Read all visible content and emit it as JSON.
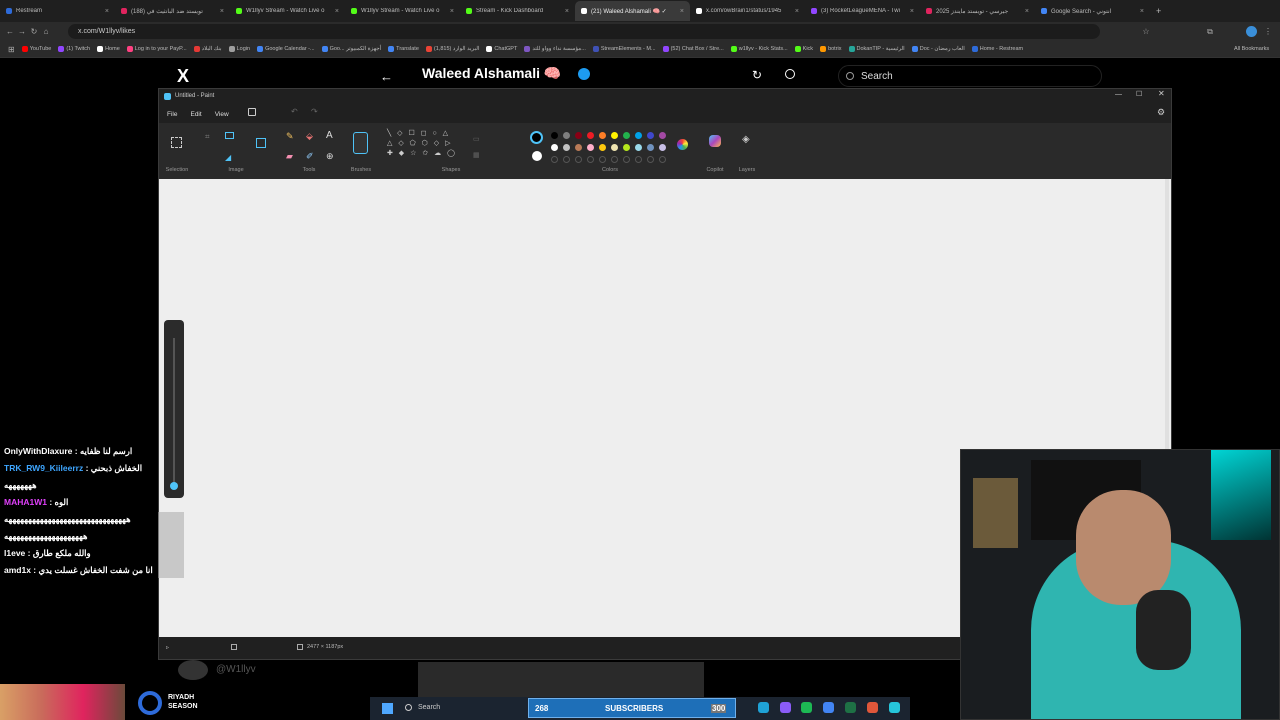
{
  "browser": {
    "tabs": [
      {
        "label": "Restream",
        "color": "#2e6bd9"
      },
      {
        "label": "تويستد ضد البانثيث في (188)",
        "color": "#e0245e"
      },
      {
        "label": "W1llyv Stream - Watch Live o",
        "color": "#53fc18"
      },
      {
        "label": "W1llyv Stream - Watch Live o",
        "color": "#53fc18"
      },
      {
        "label": "Stream - Kick Dashboard",
        "color": "#53fc18"
      },
      {
        "label": "(21) Waleed Alshamali 🧠 ✓",
        "color": "#ffffff"
      },
      {
        "label": "x.com/owBrain1/status/1945",
        "color": "#ffffff"
      },
      {
        "label": "(3) RocketLeagueMENA - Twi",
        "color": "#9146ff"
      },
      {
        "label": "جيرسي - تويستد مايندز 2025",
        "color": "#e0245e"
      },
      {
        "label": "Google Search - انتوني",
        "color": "#4285f4"
      }
    ],
    "url": "x.com/W1llyv/likes",
    "bookmarks": [
      {
        "label": "YouTube",
        "color": "#ff0000"
      },
      {
        "label": "(1) Twitch",
        "color": "#9146ff"
      },
      {
        "label": "Home",
        "color": "#ffffff"
      },
      {
        "label": "Log in to your PayP...",
        "color": "#ff4081"
      },
      {
        "label": "بنك البلاد",
        "color": "#e53935"
      },
      {
        "label": "Login",
        "color": "#9e9e9e"
      },
      {
        "label": "Google Calendar -...",
        "color": "#4285f4"
      },
      {
        "label": "Goo... أجهزة الكمبيوتر",
        "color": "#4285f4"
      },
      {
        "label": "Translate",
        "color": "#4285f4"
      },
      {
        "label": "(1,815) البريد الوارد",
        "color": "#ea4335"
      },
      {
        "label": "ChatGPT",
        "color": "#ffffff"
      },
      {
        "label": "مؤسسة نداء وواو للتد...",
        "color": "#7e57c2"
      },
      {
        "label": "StreamElements - M...",
        "color": "#3f51b5"
      },
      {
        "label": "(52) Chat Box / Stre...",
        "color": "#9146ff"
      },
      {
        "label": "w1llyv - Kick Stats...",
        "color": "#53fc18"
      },
      {
        "label": "Kick",
        "color": "#53fc18"
      },
      {
        "label": "botrix",
        "color": "#ff9800"
      },
      {
        "label": "DokanTIP - الرئيسية",
        "color": "#26a69a"
      },
      {
        "label": "Doc - العاب رمضان",
        "color": "#4285f4"
      },
      {
        "label": "Home - Restream",
        "color": "#2e6bd9"
      }
    ],
    "all_bookmarks": "All Bookmarks"
  },
  "x_page": {
    "logo": "X",
    "profile_name": "Waleed Alshamali 🧠",
    "search_placeholder": "Search",
    "footer_handle": "@W1llyv"
  },
  "paint": {
    "title": "Untitled - Paint",
    "menu": [
      "File",
      "Edit",
      "View"
    ],
    "groups": {
      "selection": "Selection",
      "image": "Image",
      "tools": "Tools",
      "brushes": "Brushes",
      "shapes": "Shapes",
      "colors": "Colors",
      "copilot": "Copilot",
      "layers": "Layers"
    },
    "palette_row1": [
      "#000000",
      "#7f7f7f",
      "#880015",
      "#ed1c24",
      "#ff7f27",
      "#fff200",
      "#22b14c",
      "#00a2e8",
      "#3f48cc",
      "#a349a4"
    ],
    "palette_row2": [
      "#ffffff",
      "#c3c3c3",
      "#b97a57",
      "#ffaec9",
      "#ffc90e",
      "#efe4b0",
      "#b5e61d",
      "#99d9ea",
      "#7092be",
      "#c8bfe7"
    ],
    "canvas_size": "2477 × 1187px"
  },
  "chat": [
    {
      "user": "OnlyWithDlaxure",
      "text": "ارسم لنا ظفايه",
      "user_color": "#ffffff"
    },
    {
      "user": "TRK_RW9_Kiileerrz",
      "text": "الخفاش ذبحني",
      "user_color": "#3ea6ff"
    },
    {
      "user": "",
      "text": "هههههههه",
      "user_color": "#ffffff"
    },
    {
      "user": "MAHA1W1",
      "text": "الوه",
      "user_color": "#e040fb"
    },
    {
      "user": "",
      "text": "هههههههههههههههههههههههههههههههه",
      "user_color": "#ffffff"
    },
    {
      "user": "",
      "text": "ههههههههههههههههههههه",
      "user_color": "#ffffff"
    },
    {
      "user": "l1eve",
      "text": "والله ملكع طارق",
      "user_color": "#ffffff"
    },
    {
      "user": "amd1x",
      "text": "انا من شفت الخفاش غسلت يدي",
      "user_color": "#ffffff"
    }
  ],
  "taskbar": {
    "search": "Search",
    "subs_current": "268",
    "subs_label": "SUBSCRIBERS",
    "subs_goal": "300"
  },
  "sponsor": {
    "line1": "RIYADH",
    "line2": "SEASON"
  }
}
